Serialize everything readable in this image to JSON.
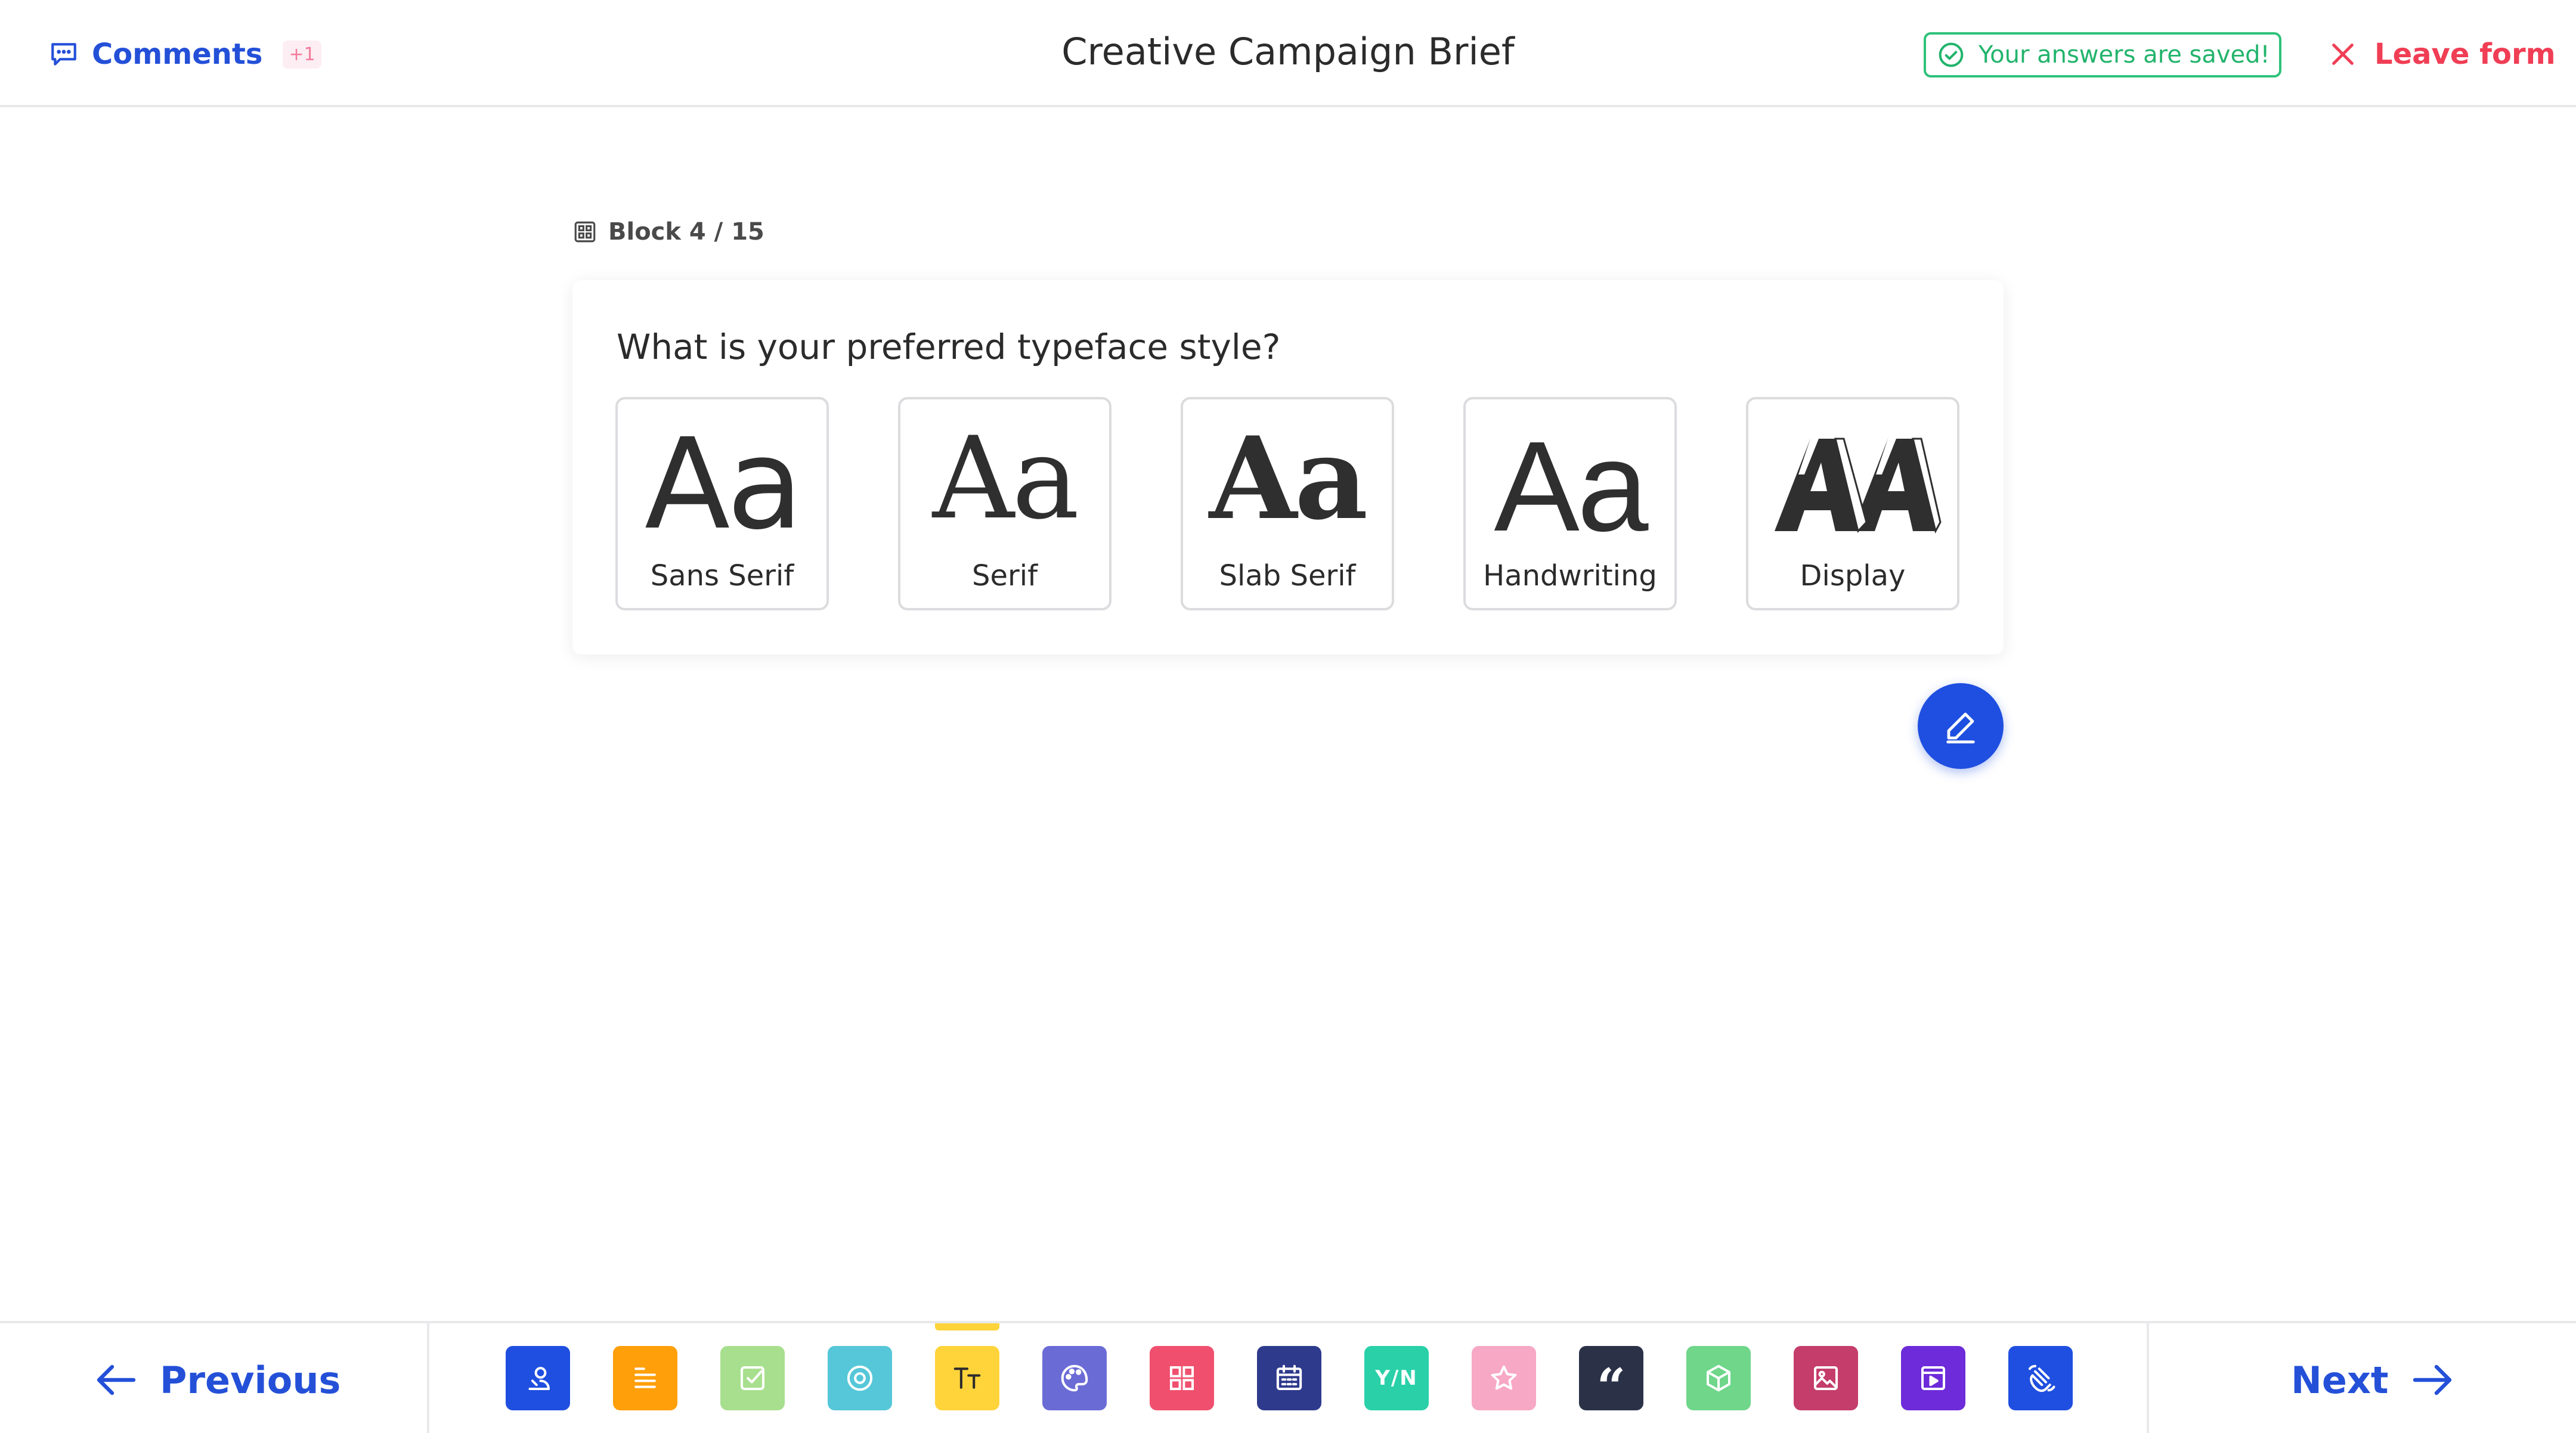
{
  "header": {
    "comments_label": "Comments",
    "comments_count": "+1",
    "title": "Creative Campaign Brief",
    "saved_status": "Your answers are saved!",
    "leave_label": "Leave form"
  },
  "block": {
    "label": "Block 4 / 15"
  },
  "question": {
    "text": "What is your preferred typeface style?",
    "options": [
      {
        "label": "Sans Serif",
        "glyph": "Aa"
      },
      {
        "label": "Serif",
        "glyph": "Aa"
      },
      {
        "label": "Slab Serif",
        "glyph": "Aa"
      },
      {
        "label": "Handwriting",
        "glyph": "Aa"
      },
      {
        "label": "Display",
        "glyph": "AA"
      }
    ]
  },
  "footer": {
    "previous_label": "Previous",
    "next_label": "Next",
    "yes_no_text": "Y/N",
    "quote_text": "“",
    "block_types": [
      {
        "name": "contact-info-block",
        "icon": "contact-icon",
        "color": "#1f4fe0"
      },
      {
        "name": "long-text-block",
        "icon": "text-lines-icon",
        "color": "#ff9f0a"
      },
      {
        "name": "checkbox-block",
        "icon": "checkbox-icon",
        "color": "#a8df8e"
      },
      {
        "name": "single-choice-block",
        "icon": "radio-icon",
        "color": "#56c7d8"
      },
      {
        "name": "typeface-block",
        "icon": "typeface-icon",
        "color": "#ffd43b",
        "active": true
      },
      {
        "name": "color-palette-block",
        "icon": "palette-icon",
        "color": "#6b6bd6"
      },
      {
        "name": "grid-block",
        "icon": "grid-icon",
        "color": "#f0506e"
      },
      {
        "name": "date-block",
        "icon": "calendar-icon",
        "color": "#2e3a8c"
      },
      {
        "name": "yes-no-block",
        "icon": "yes-no-icon",
        "color": "#2ad0a8"
      },
      {
        "name": "rating-block",
        "icon": "star-icon",
        "color": "#f7a8c4"
      },
      {
        "name": "quote-block",
        "icon": "quote-icon",
        "color": "#2b3248"
      },
      {
        "name": "3d-block",
        "icon": "cube-icon",
        "color": "#6fd68a"
      },
      {
        "name": "image-block",
        "icon": "image-icon",
        "color": "#c43d6b"
      },
      {
        "name": "video-block",
        "icon": "video-icon",
        "color": "#6d2bd9"
      },
      {
        "name": "gesture-block",
        "icon": "hand-icon",
        "color": "#1f4fe0"
      }
    ]
  }
}
